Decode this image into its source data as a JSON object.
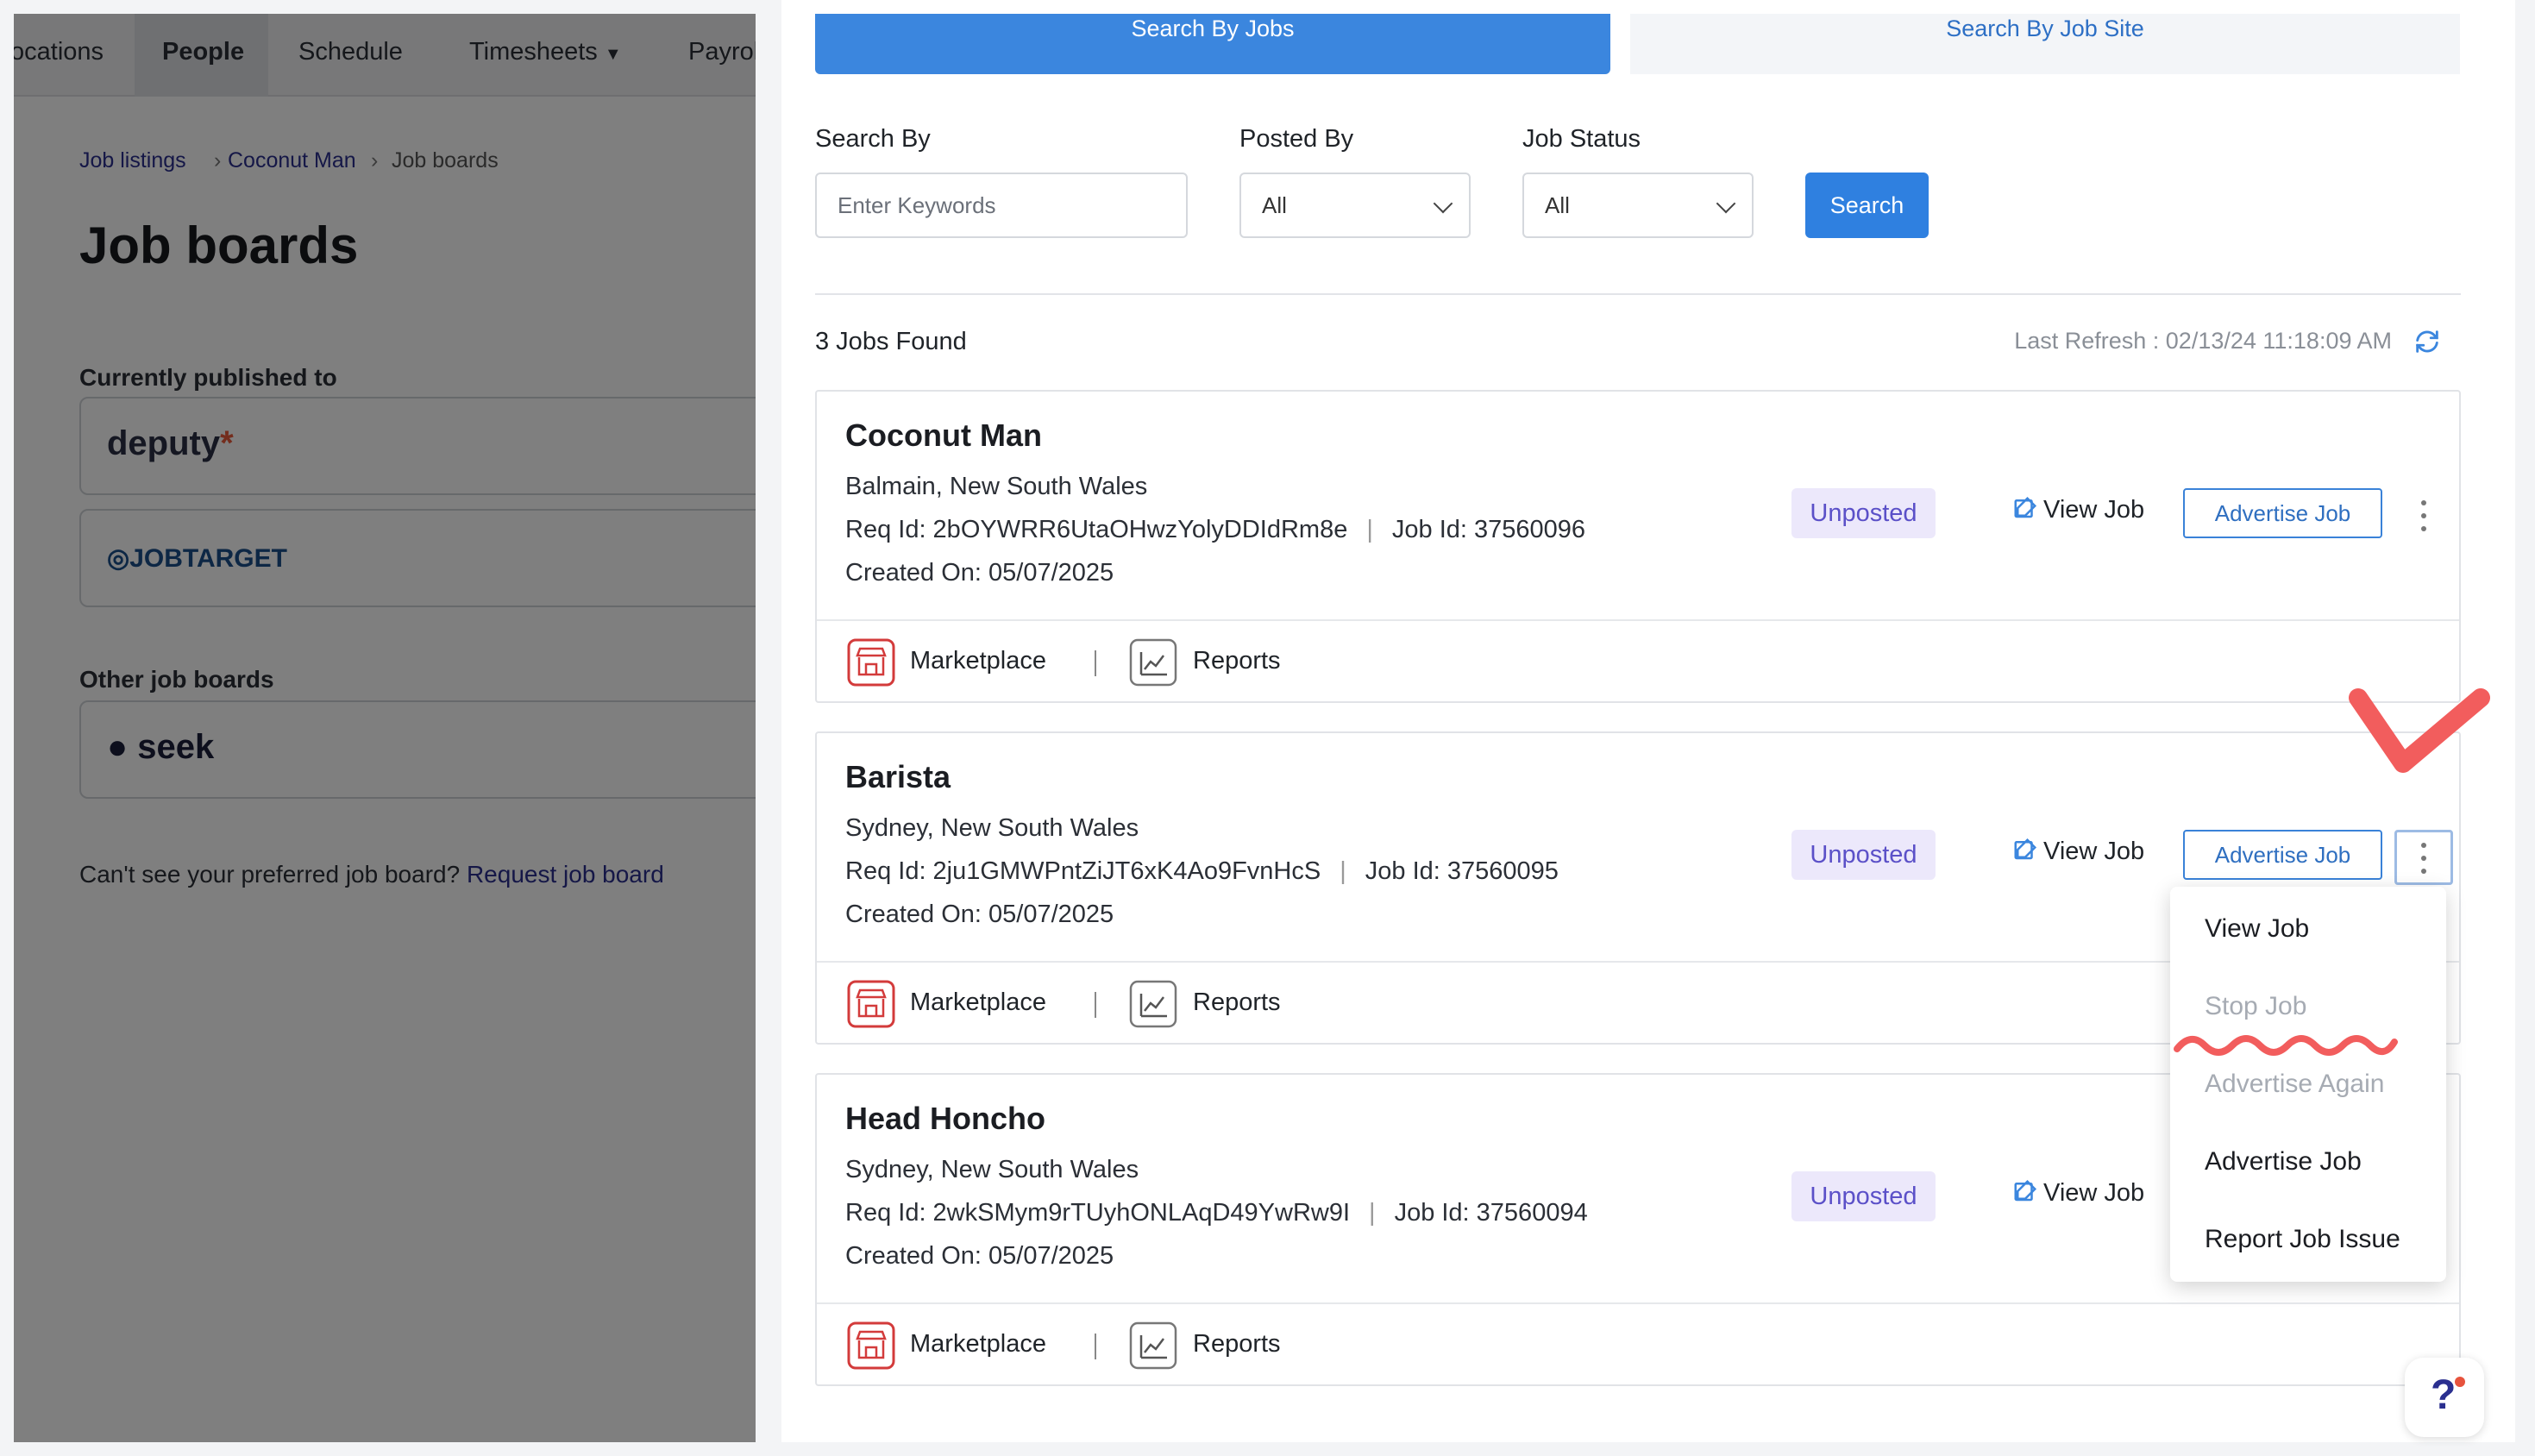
{
  "background_app": {
    "nav": [
      "ocations",
      "People",
      "Schedule",
      "Timesheets",
      "Payrol"
    ],
    "nav_active": "People",
    "breadcrumb": [
      "Job listings",
      "Coconut Man",
      "Job boards"
    ],
    "title": "Job boards",
    "published_heading": "Currently published to",
    "published_boards": [
      "deputy",
      "JOBTARGET"
    ],
    "other_heading": "Other job boards",
    "other_boards": [
      "seek"
    ],
    "request_text": "Can't see your preferred job board?",
    "request_link": "Request job board"
  },
  "tabs": {
    "by_jobs": "Search By Jobs",
    "by_job_site": "Search By Job Site"
  },
  "filters": {
    "search_by_label": "Search By",
    "search_placeholder": "Enter Keywords",
    "posted_by_label": "Posted By",
    "posted_by_value": "All",
    "job_status_label": "Job Status",
    "job_status_value": "All",
    "search_button": "Search"
  },
  "results": {
    "count_text": "3 Jobs Found",
    "last_refresh": "Last Refresh : 02/13/24 11:18:09 AM"
  },
  "jobs": [
    {
      "title": "Coconut Man",
      "location": "Balmain, New South Wales",
      "req_id": "Req Id: 2bOYWRR6UtaOHwzYolyDDIdRm8e",
      "job_id": "Job Id: 37560096",
      "created": "Created On: 05/07/2025",
      "status": "Unposted",
      "view_label": "View Job",
      "advertise_label": "Advertise Job",
      "marketplace": "Marketplace",
      "reports": "Reports"
    },
    {
      "title": "Barista",
      "location": "Sydney, New South Wales",
      "req_id": "Req Id: 2ju1GMWPntZiJT6xK4Ao9FvnHcS",
      "job_id": "Job Id: 37560095",
      "created": "Created On: 05/07/2025",
      "status": "Unposted",
      "view_label": "View Job",
      "advertise_label": "Advertise Job",
      "marketplace": "Marketplace",
      "reports": "Reports"
    },
    {
      "title": "Head Honcho",
      "location": "Sydney, New South Wales",
      "req_id": "Req Id: 2wkSMym9rTUyhONLAqD49YwRw9I",
      "job_id": "Job Id: 37560094",
      "created": "Created On: 05/07/2025",
      "status": "Unposted",
      "view_label": "View Job",
      "advertise_label": "Advertise Job",
      "marketplace": "Marketplace",
      "reports": "Reports"
    }
  ],
  "dropdown": {
    "items": [
      "View Job",
      "Stop Job",
      "Advertise Again",
      "Advertise Job",
      "Report Job Issue"
    ],
    "disabled": [
      "Stop Job",
      "Advertise Again"
    ]
  },
  "help": {
    "label": "?"
  },
  "colors": {
    "primary": "#2f80e0",
    "badge_bg": "#ece8fb",
    "badge_text": "#5b50c8",
    "annotation": "#f25d5d"
  }
}
